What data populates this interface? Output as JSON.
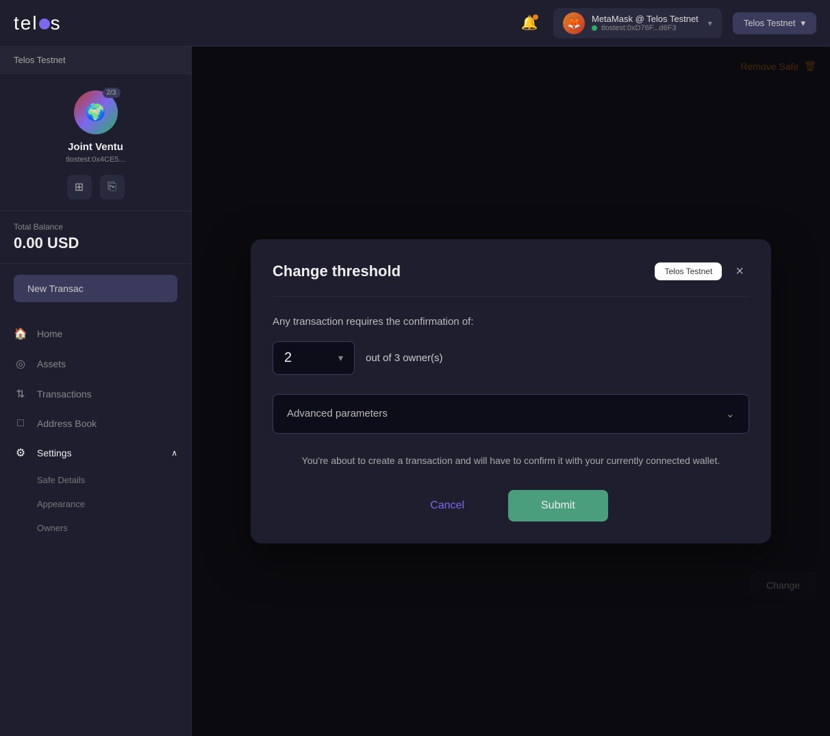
{
  "header": {
    "logo": "telos",
    "bell_icon": "bell",
    "wallet": {
      "name": "MetaMask @ Telos Testnet",
      "address": "tlostest:0xD76F...d6F3",
      "dot_color": "#27ae60"
    },
    "network_label": "Telos Testnet",
    "network_chevron": "▾"
  },
  "sidebar": {
    "tab_label": "Telos Testnet",
    "safe_name": "Joint Ventu",
    "safe_address": "tlostest:0x4CE5...",
    "safe_badge": "2/3",
    "balance_label": "Total Balance",
    "balance": "0.00 USD",
    "new_tx_label": "New Transac",
    "nav_items": [
      {
        "id": "home",
        "icon": "🏠",
        "label": "Home"
      },
      {
        "id": "assets",
        "icon": "⊙",
        "label": "Assets"
      },
      {
        "id": "transactions",
        "icon": "↕",
        "label": "Transactions"
      },
      {
        "id": "address-book",
        "icon": "□",
        "label": "Address Book"
      },
      {
        "id": "settings",
        "icon": "⚙",
        "label": "Settings",
        "expanded": true
      }
    ],
    "settings_subitems": [
      {
        "id": "safe-details",
        "label": "Safe Details"
      },
      {
        "id": "appearance",
        "label": "Appearance"
      },
      {
        "id": "owners",
        "label": "Owners"
      }
    ]
  },
  "background": {
    "remove_safe_label": "Remove Safe",
    "change_label": "Change"
  },
  "modal": {
    "title": "Change threshold",
    "network_badge": "Telos Testnet",
    "close_icon": "×",
    "confirmation_text": "Any transaction requires the confirmation of:",
    "threshold_value": "2",
    "threshold_label": "out of 3 owner(s)",
    "advanced_params_label": "Advanced parameters",
    "advanced_params_chevron": "⌄",
    "confirm_description": "You're about to create a transaction and will have to confirm it with your currently connected wallet.",
    "cancel_label": "Cancel",
    "submit_label": "Submit"
  }
}
